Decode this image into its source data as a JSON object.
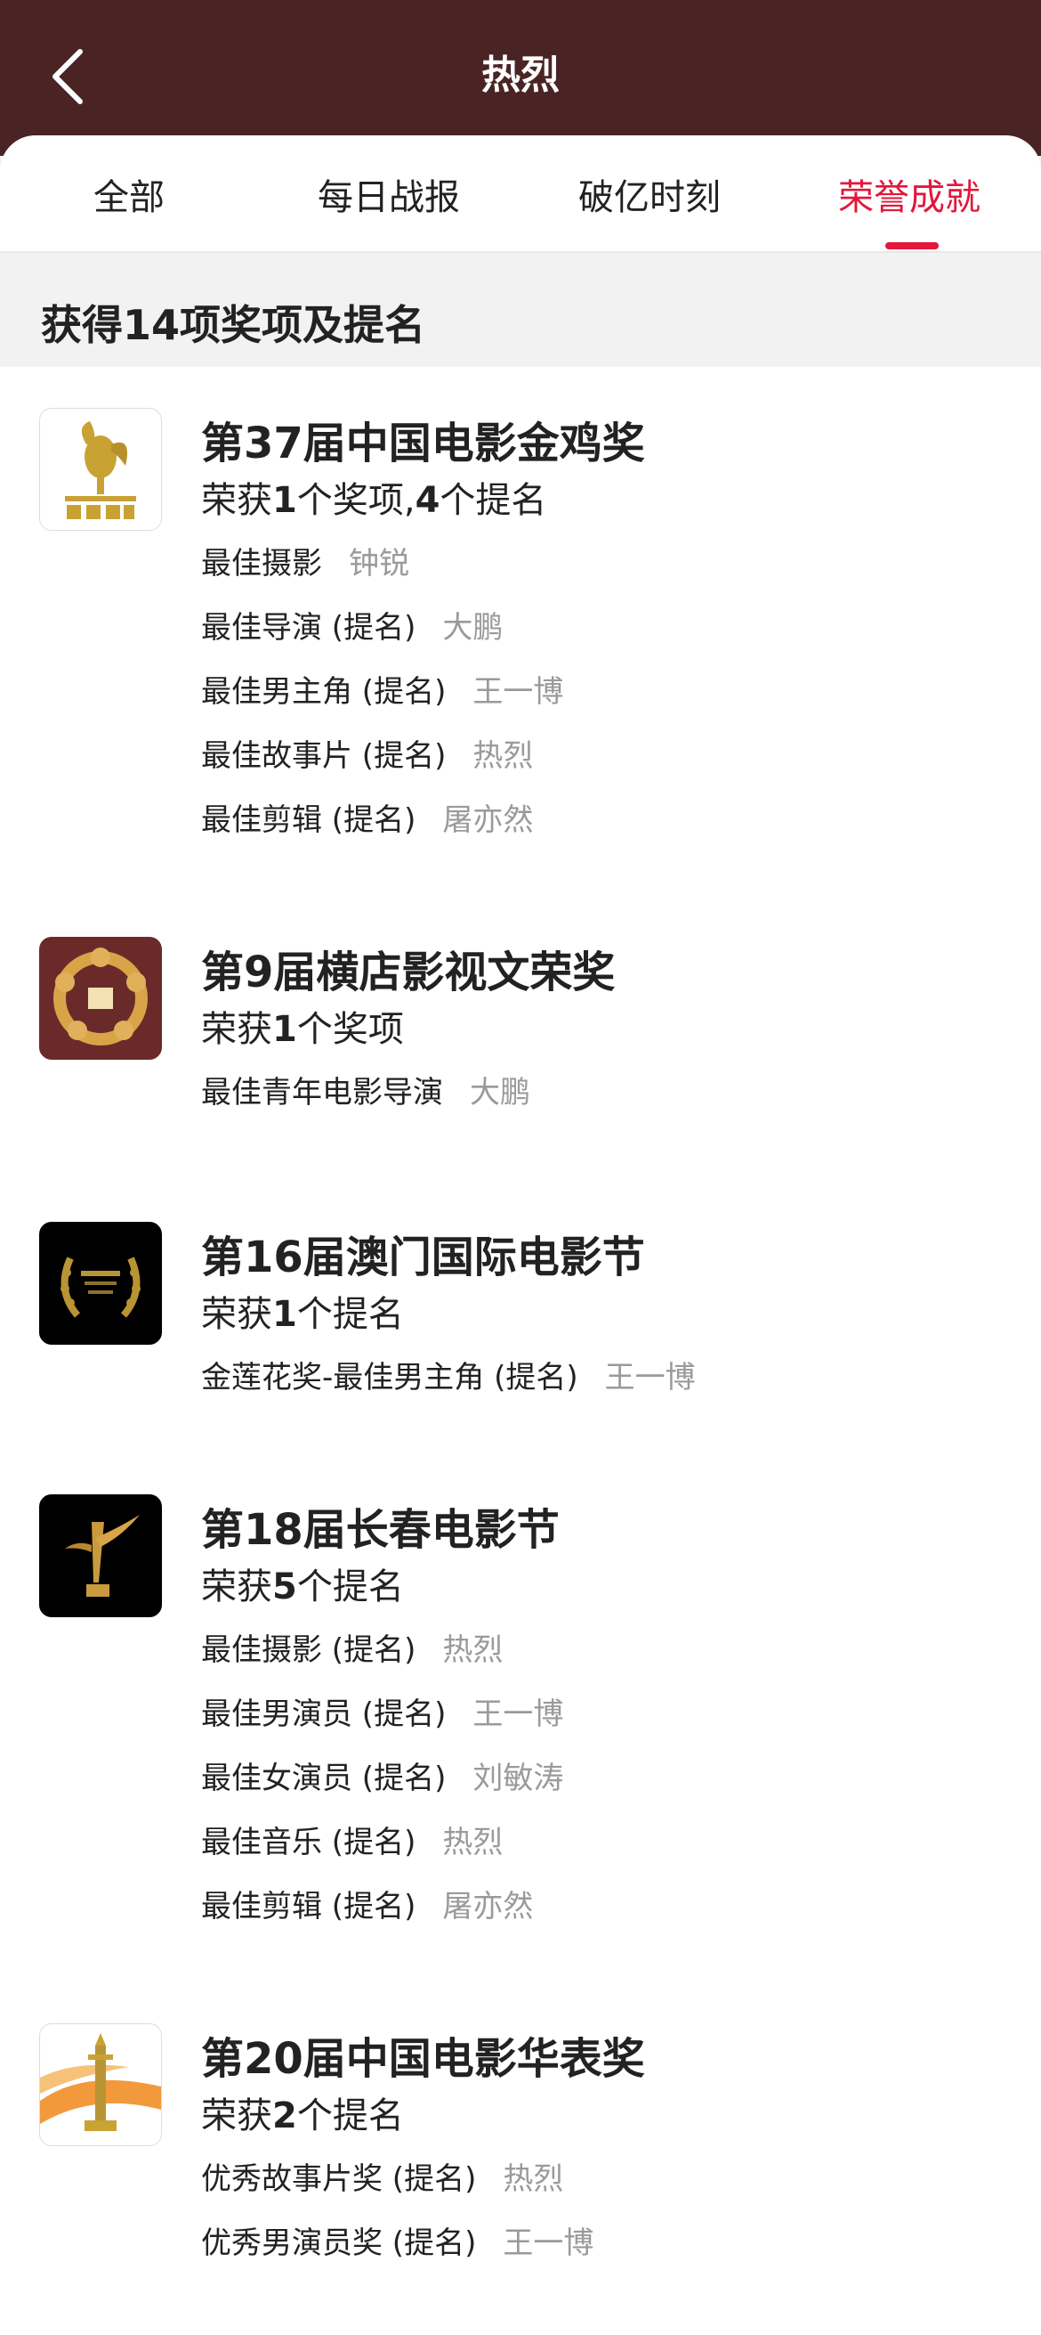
{
  "header": {
    "title": "热烈",
    "back_icon": "chevron-left-icon"
  },
  "tabs": [
    {
      "label": "全部"
    },
    {
      "label": "每日战报"
    },
    {
      "label": "破亿时刻"
    },
    {
      "label": "荣誉成就",
      "active": true
    }
  ],
  "summary": "获得14项奖项及提名",
  "colors": {
    "header_bg": "#4a2424",
    "accent": "#e3173b",
    "secondary_text": "#9a9a9a"
  },
  "awards": [
    {
      "title": "第37届中国电影金鸡奖",
      "summary": {
        "prefix": "荣获",
        "n1": "1",
        "mid": "个奖项,",
        "n2": "4",
        "suffix": "个提名"
      },
      "logo_icon": "golden-rooster-logo",
      "items": [
        {
          "name": "最佳摄影",
          "person": "钟锐"
        },
        {
          "name": "最佳导演 (提名)",
          "person": "大鹏"
        },
        {
          "name": "最佳男主角 (提名)",
          "person": "王一博"
        },
        {
          "name": "最佳故事片 (提名)",
          "person": "热烈"
        },
        {
          "name": "最佳剪辑 (提名)",
          "person": "屠亦然"
        }
      ]
    },
    {
      "title": "第9届横店影视文荣奖",
      "summary": {
        "prefix": "荣获",
        "n1": "1",
        "suffix": "个奖项"
      },
      "logo_icon": "wenrong-award-logo",
      "items": [
        {
          "name": "最佳青年电影导演",
          "person": "大鹏"
        }
      ]
    },
    {
      "title": "第16届澳门国际电影节",
      "summary": {
        "prefix": "荣获",
        "n1": "1",
        "suffix": "个提名"
      },
      "logo_icon": "macau-festival-logo",
      "items": [
        {
          "name": "金莲花奖-最佳男主角 (提名)",
          "person": "王一博"
        }
      ]
    },
    {
      "title": "第18届长春电影节",
      "summary": {
        "prefix": "荣获",
        "n1": "5",
        "suffix": "个提名"
      },
      "logo_icon": "changchun-festival-logo",
      "items": [
        {
          "name": "最佳摄影 (提名)",
          "person": "热烈"
        },
        {
          "name": "最佳男演员 (提名)",
          "person": "王一博"
        },
        {
          "name": "最佳女演员 (提名)",
          "person": "刘敏涛"
        },
        {
          "name": "最佳音乐 (提名)",
          "person": "热烈"
        },
        {
          "name": "最佳剪辑 (提名)",
          "person": "屠亦然"
        }
      ]
    },
    {
      "title": "第20届中国电影华表奖",
      "summary": {
        "prefix": "荣获",
        "n1": "2",
        "suffix": "个提名"
      },
      "logo_icon": "huabiao-award-logo",
      "items": [
        {
          "name": "优秀故事片奖 (提名)",
          "person": "热烈"
        },
        {
          "name": "优秀男演员奖 (提名)",
          "person": "王一博"
        }
      ]
    }
  ]
}
